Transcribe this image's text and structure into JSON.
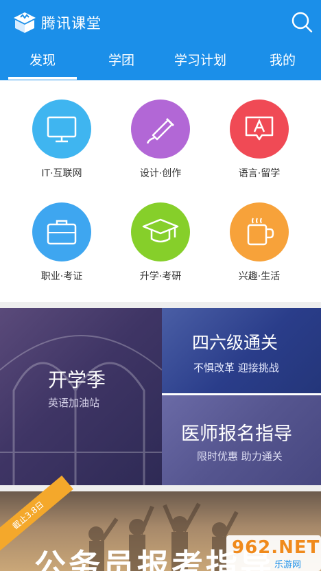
{
  "header": {
    "app_title": "腾讯课堂",
    "logo_icon": "tencent-classroom-logo",
    "search_icon": "search-icon",
    "bg_color": "#1b8fe9"
  },
  "tabs": [
    {
      "label": "发现",
      "active": true
    },
    {
      "label": "学团",
      "active": false
    },
    {
      "label": "学习计划",
      "active": false
    },
    {
      "label": "我的",
      "active": false
    }
  ],
  "categories": [
    {
      "label": "IT·互联网",
      "icon": "monitor-icon",
      "color": "#3fb5f0"
    },
    {
      "label": "设计·创作",
      "icon": "paint-tube-icon",
      "color": "#b267d6"
    },
    {
      "label": "语言·留学",
      "icon": "language-bubble-icon",
      "color": "#f04a55"
    },
    {
      "label": "职业·考证",
      "icon": "briefcase-icon",
      "color": "#3ea6f0"
    },
    {
      "label": "升学·考研",
      "icon": "graduation-cap-icon",
      "color": "#86cf2a"
    },
    {
      "label": "兴趣·生活",
      "icon": "coffee-mug-icon",
      "color": "#f7a23a"
    }
  ],
  "promos": {
    "main": {
      "title": "开学季",
      "subtitle": "英语加油站"
    },
    "top": {
      "title": "四六级通关",
      "subtitle": "不惧改革 迎接挑战"
    },
    "bottom": {
      "title": "医师报名指导",
      "subtitle": "限时优惠 助力通关"
    }
  },
  "banner": {
    "ribbon": "截止3.8日",
    "title": "公务员报考指导"
  },
  "watermark": {
    "main": "962.NET",
    "sub": "乐游网"
  }
}
